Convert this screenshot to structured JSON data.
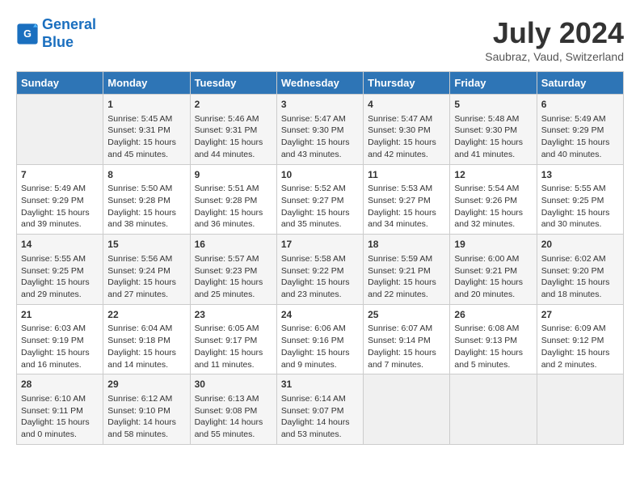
{
  "header": {
    "logo_line1": "General",
    "logo_line2": "Blue",
    "month": "July 2024",
    "location": "Saubraz, Vaud, Switzerland"
  },
  "columns": [
    "Sunday",
    "Monday",
    "Tuesday",
    "Wednesday",
    "Thursday",
    "Friday",
    "Saturday"
  ],
  "weeks": [
    [
      {
        "day": "",
        "info": ""
      },
      {
        "day": "1",
        "info": "Sunrise: 5:45 AM\nSunset: 9:31 PM\nDaylight: 15 hours\nand 45 minutes."
      },
      {
        "day": "2",
        "info": "Sunrise: 5:46 AM\nSunset: 9:31 PM\nDaylight: 15 hours\nand 44 minutes."
      },
      {
        "day": "3",
        "info": "Sunrise: 5:47 AM\nSunset: 9:30 PM\nDaylight: 15 hours\nand 43 minutes."
      },
      {
        "day": "4",
        "info": "Sunrise: 5:47 AM\nSunset: 9:30 PM\nDaylight: 15 hours\nand 42 minutes."
      },
      {
        "day": "5",
        "info": "Sunrise: 5:48 AM\nSunset: 9:30 PM\nDaylight: 15 hours\nand 41 minutes."
      },
      {
        "day": "6",
        "info": "Sunrise: 5:49 AM\nSunset: 9:29 PM\nDaylight: 15 hours\nand 40 minutes."
      }
    ],
    [
      {
        "day": "7",
        "info": "Sunrise: 5:49 AM\nSunset: 9:29 PM\nDaylight: 15 hours\nand 39 minutes."
      },
      {
        "day": "8",
        "info": "Sunrise: 5:50 AM\nSunset: 9:28 PM\nDaylight: 15 hours\nand 38 minutes."
      },
      {
        "day": "9",
        "info": "Sunrise: 5:51 AM\nSunset: 9:28 PM\nDaylight: 15 hours\nand 36 minutes."
      },
      {
        "day": "10",
        "info": "Sunrise: 5:52 AM\nSunset: 9:27 PM\nDaylight: 15 hours\nand 35 minutes."
      },
      {
        "day": "11",
        "info": "Sunrise: 5:53 AM\nSunset: 9:27 PM\nDaylight: 15 hours\nand 34 minutes."
      },
      {
        "day": "12",
        "info": "Sunrise: 5:54 AM\nSunset: 9:26 PM\nDaylight: 15 hours\nand 32 minutes."
      },
      {
        "day": "13",
        "info": "Sunrise: 5:55 AM\nSunset: 9:25 PM\nDaylight: 15 hours\nand 30 minutes."
      }
    ],
    [
      {
        "day": "14",
        "info": "Sunrise: 5:55 AM\nSunset: 9:25 PM\nDaylight: 15 hours\nand 29 minutes."
      },
      {
        "day": "15",
        "info": "Sunrise: 5:56 AM\nSunset: 9:24 PM\nDaylight: 15 hours\nand 27 minutes."
      },
      {
        "day": "16",
        "info": "Sunrise: 5:57 AM\nSunset: 9:23 PM\nDaylight: 15 hours\nand 25 minutes."
      },
      {
        "day": "17",
        "info": "Sunrise: 5:58 AM\nSunset: 9:22 PM\nDaylight: 15 hours\nand 23 minutes."
      },
      {
        "day": "18",
        "info": "Sunrise: 5:59 AM\nSunset: 9:21 PM\nDaylight: 15 hours\nand 22 minutes."
      },
      {
        "day": "19",
        "info": "Sunrise: 6:00 AM\nSunset: 9:21 PM\nDaylight: 15 hours\nand 20 minutes."
      },
      {
        "day": "20",
        "info": "Sunrise: 6:02 AM\nSunset: 9:20 PM\nDaylight: 15 hours\nand 18 minutes."
      }
    ],
    [
      {
        "day": "21",
        "info": "Sunrise: 6:03 AM\nSunset: 9:19 PM\nDaylight: 15 hours\nand 16 minutes."
      },
      {
        "day": "22",
        "info": "Sunrise: 6:04 AM\nSunset: 9:18 PM\nDaylight: 15 hours\nand 14 minutes."
      },
      {
        "day": "23",
        "info": "Sunrise: 6:05 AM\nSunset: 9:17 PM\nDaylight: 15 hours\nand 11 minutes."
      },
      {
        "day": "24",
        "info": "Sunrise: 6:06 AM\nSunset: 9:16 PM\nDaylight: 15 hours\nand 9 minutes."
      },
      {
        "day": "25",
        "info": "Sunrise: 6:07 AM\nSunset: 9:14 PM\nDaylight: 15 hours\nand 7 minutes."
      },
      {
        "day": "26",
        "info": "Sunrise: 6:08 AM\nSunset: 9:13 PM\nDaylight: 15 hours\nand 5 minutes."
      },
      {
        "day": "27",
        "info": "Sunrise: 6:09 AM\nSunset: 9:12 PM\nDaylight: 15 hours\nand 2 minutes."
      }
    ],
    [
      {
        "day": "28",
        "info": "Sunrise: 6:10 AM\nSunset: 9:11 PM\nDaylight: 15 hours\nand 0 minutes."
      },
      {
        "day": "29",
        "info": "Sunrise: 6:12 AM\nSunset: 9:10 PM\nDaylight: 14 hours\nand 58 minutes."
      },
      {
        "day": "30",
        "info": "Sunrise: 6:13 AM\nSunset: 9:08 PM\nDaylight: 14 hours\nand 55 minutes."
      },
      {
        "day": "31",
        "info": "Sunrise: 6:14 AM\nSunset: 9:07 PM\nDaylight: 14 hours\nand 53 minutes."
      },
      {
        "day": "",
        "info": ""
      },
      {
        "day": "",
        "info": ""
      },
      {
        "day": "",
        "info": ""
      }
    ]
  ]
}
